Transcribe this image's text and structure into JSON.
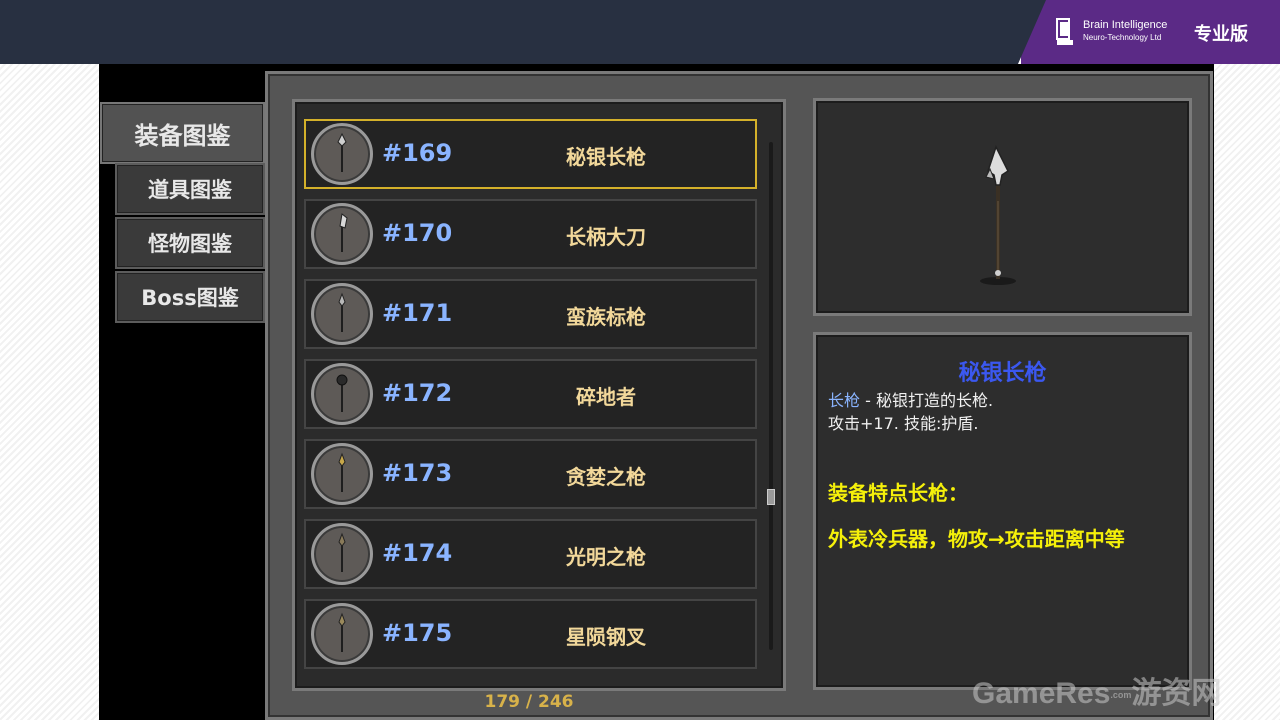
{
  "brand": {
    "name_line1": "Brain Intelligence",
    "name_line2": "Neuro-Technology Ltd",
    "edition": "专业版",
    "color": "#5b2a86"
  },
  "tabs": [
    {
      "label": "装备图鉴",
      "active": true
    },
    {
      "label": "道具图鉴",
      "active": false
    },
    {
      "label": "怪物图鉴",
      "active": false
    },
    {
      "label": "Boss图鉴",
      "active": false
    }
  ],
  "items": [
    {
      "num": "#169",
      "name": "秘银长枪",
      "selected": true
    },
    {
      "num": "#170",
      "name": "长柄大刀",
      "selected": false
    },
    {
      "num": "#171",
      "name": "蛮族标枪",
      "selected": false
    },
    {
      "num": "#172",
      "name": "碎地者",
      "selected": false
    },
    {
      "num": "#173",
      "name": "贪婪之枪",
      "selected": false
    },
    {
      "num": "#174",
      "name": "光明之枪",
      "selected": false
    },
    {
      "num": "#175",
      "name": "星陨钢叉",
      "selected": false
    }
  ],
  "pagination": "179 / 246",
  "detail": {
    "title": "秘银长枪",
    "type": "长枪",
    "desc": " - 秘银打造的长枪.",
    "stats": "攻击+17. 技能:护盾.",
    "feature_heading": "装备特点长枪：",
    "feature_text": "外表冷兵器，物攻→攻击距离中等"
  },
  "watermark": {
    "main": "GameRes",
    "small": ".com",
    "cn": "游资网"
  },
  "colors": {
    "selected_border": "#d4b12a",
    "item_number": "#8ab4ff",
    "item_name": "#f2d89a",
    "detail_title": "#3b58f0",
    "feature_text": "#f5f00a"
  }
}
